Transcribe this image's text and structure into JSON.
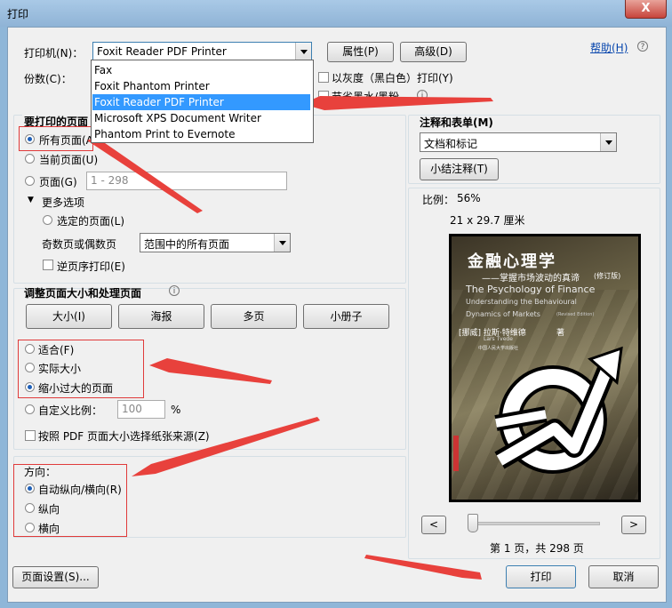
{
  "window": {
    "title": "打印",
    "close_label": "X"
  },
  "printer": {
    "label": "打印机(N)：",
    "selected": "Foxit Reader PDF Printer",
    "properties_button": "属性(P)",
    "advanced_button": "高级(D)",
    "help_link": "帮助(H)",
    "help_icon": "?",
    "copies_label": "份数(C)：",
    "options": [
      "Fax",
      "Foxit Phantom Printer",
      "Foxit Reader PDF Printer",
      "Microsoft XPS Document Writer",
      "Phantom Print to Evernote"
    ],
    "grayscale_label": "以灰度（黑白色）打印(Y)",
    "save_ink_label": "节省墨水/墨粉",
    "info_icon": "i"
  },
  "pages": {
    "group_title": "要打印的页面",
    "all_label": "所有页面(A",
    "current_label": "当前页面(U)",
    "range_label": "页面(G)",
    "range_value": "1 - 298",
    "more_options": "更多选项",
    "selected_label": "选定的页面(L)",
    "odd_even_label": "奇数页或偶数页",
    "odd_even_value": "范围中的所有页面",
    "reverse_label": "逆页序打印(E)"
  },
  "sizing": {
    "group_title": "调整页面大小和处理页面",
    "info_icon": "i",
    "tabs": [
      "大小(I)",
      "海报",
      "多页",
      "小册子"
    ],
    "fit_label": "适合(F)",
    "actual_label": "实际大小",
    "shrink_label": "缩小过大的页面",
    "custom_label": "自定义比例：",
    "custom_value": "100",
    "percent": "%",
    "choose_paper_label": "按照 PDF 页面大小选择纸张来源(Z)"
  },
  "orientation": {
    "group_title": "方向：",
    "auto_label": "自动纵向/横向(R)",
    "portrait_label": "纵向",
    "landscape_label": "横向"
  },
  "comments": {
    "group_title": "注释和表单(M)",
    "selected": "文档和标记",
    "summarize_button": "小结注释(T)"
  },
  "preview": {
    "scale_label": "比例：",
    "scale_value": "56%",
    "size_label": "21 x 29.7 厘米",
    "book_title": "金融心理学",
    "book_subtitle": "——掌握市场波动的真谛",
    "book_edition": "(修订版)",
    "book_title_en1": "The Psychology of Finance",
    "book_title_en2": "Understanding the Behavioural",
    "book_title_en3": "Dynamics of Markets",
    "book_title_en3_small": "(Revised Edition)",
    "book_author_cn": "[挪威] 拉斯·特维德",
    "book_author_suffix": "著",
    "book_author_en": "Lars Tvede",
    "book_publisher": "中国人民大学出版社",
    "prev_button": "<",
    "next_button": ">",
    "page_status": "第 1 页，共 298 页"
  },
  "footer": {
    "page_setup_button": "页面设置(S)...",
    "print_button": "打印",
    "cancel_button": "取消"
  }
}
